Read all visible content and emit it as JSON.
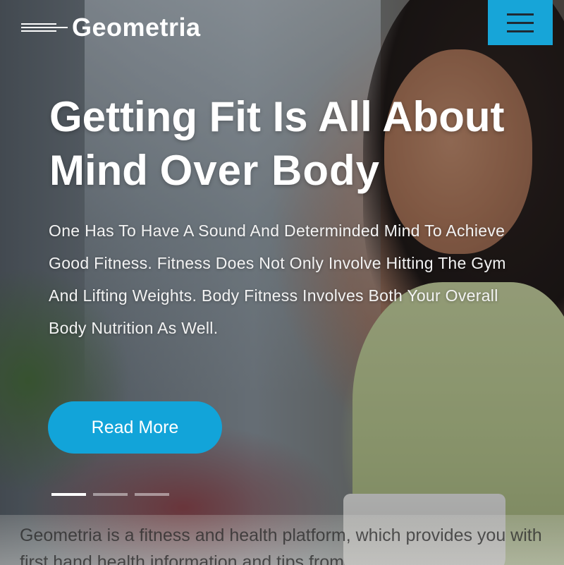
{
  "header": {
    "brand": "Geometria",
    "menu_icon": "hamburger-menu-icon"
  },
  "hero": {
    "headline_line1": "Getting Fit Is All About",
    "headline_line2_normal": "Mind",
    "headline_line2_bold": "Over Body",
    "lead": "One Has To Have A Sound And Determinded Mind To Achieve Good Fitness. Fitness Does Not Only Involve Hitting The Gym And Lifting Weights. Body Fitness Involves Both Your Overall Body Nutrition As Well.",
    "cta_label": "Read More",
    "slides": {
      "count": 3,
      "active": 1
    }
  },
  "intro": {
    "text": "Geometria is a fitness and health platform, which provides you with first hand health information and tips from"
  },
  "colors": {
    "accent": "#17a5d8",
    "text_light": "#ffffff"
  }
}
